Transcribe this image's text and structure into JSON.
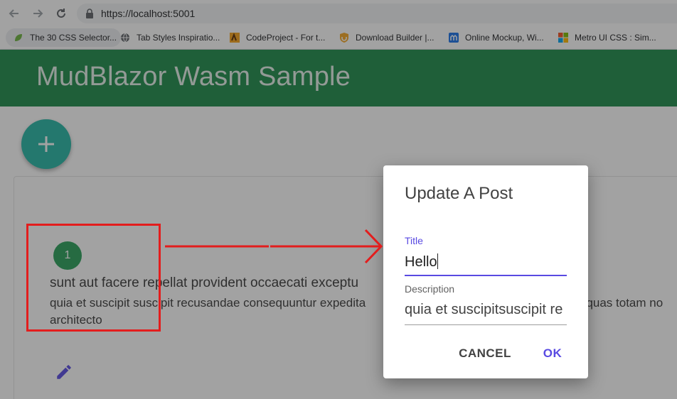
{
  "browser": {
    "url": "https://localhost:5001",
    "bookmarks": [
      {
        "label": "The 30 CSS Selector...",
        "icon": "leaf-icon"
      },
      {
        "label": "Tab Styles Inspiratio...",
        "icon": "globe-icon"
      },
      {
        "label": "CodeProject - For t...",
        "icon": "codeproject-icon"
      },
      {
        "label": "Download Builder |...",
        "icon": "shield-icon"
      },
      {
        "label": "Online Mockup, Wi...",
        "icon": "moqups-icon"
      },
      {
        "label": "Metro UI CSS : Sim...",
        "icon": "windows-tiles-icon"
      }
    ]
  },
  "app": {
    "title": "MudBlazor Wasm Sample",
    "brand_color": "#1e8c4a",
    "fab_color": "#27b7a5"
  },
  "post": {
    "id": "1",
    "title": "sunt aut facere repellat provident occaecati exceptu",
    "body_line1": "quia et suscipit suscipit recusandae consequuntur expedita",
    "body_line1_right": "t quas totam no",
    "body_line2": "architecto"
  },
  "dialog": {
    "heading": "Update A Post",
    "title_label": "Title",
    "title_value": "Hello",
    "description_label": "Description",
    "description_value": "quia et suscipitsuscipit re",
    "cancel_label": "CANCEL",
    "ok_label": "OK",
    "accent_color": "#594ae2"
  },
  "annotation": {
    "color": "#e31d1d"
  }
}
